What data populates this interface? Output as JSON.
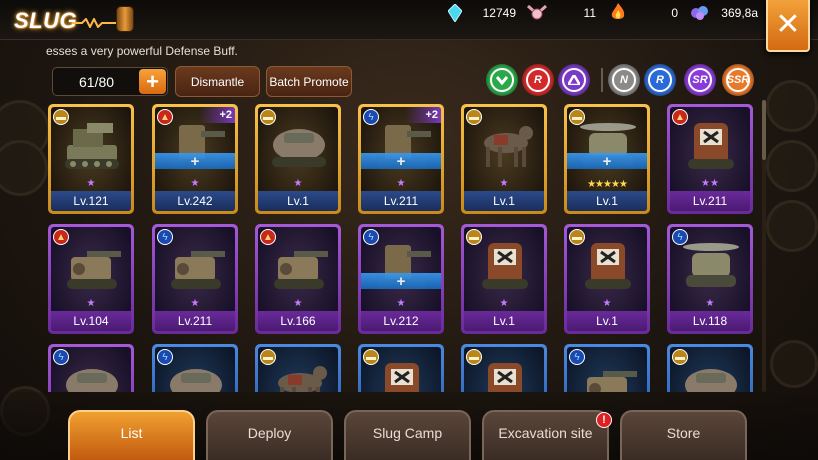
{
  "header": {
    "logo_text": "SLUG",
    "currencies": [
      {
        "icon": "crystal-icon",
        "value": "12749"
      },
      {
        "icon": "medal-icon",
        "value": "11"
      },
      {
        "icon": "fire-icon",
        "value": "0"
      },
      {
        "icon": "gem-pile-icon",
        "value": "369,8a"
      }
    ],
    "close_icon": "close-icon"
  },
  "description": "esses a very powerful Defense Buff.",
  "controls": {
    "capacity": "61/80",
    "expand_label": "+",
    "dismantle_label": "Dismantle",
    "batch_promote_label": "Batch Promote"
  },
  "filters": [
    {
      "label": "",
      "icon": "chevron-down-icon",
      "color": "#2aa84a"
    },
    {
      "label": "R",
      "icon": "rarity-r-icon",
      "color": "#d22a2a"
    },
    {
      "label": "",
      "icon": "triangle-up-icon",
      "color": "#7a3ac8"
    },
    {
      "label": "N",
      "icon": "rarity-n-icon",
      "color": "#8a8a8a"
    },
    {
      "label": "R",
      "icon": "rarity-r-blue-icon",
      "color": "#2a6ad8"
    },
    {
      "label": "SR",
      "icon": "rarity-sr-icon",
      "color": "#8a3ad8"
    },
    {
      "label": "SSR",
      "icon": "rarity-ssr-icon",
      "color": "#e8782a"
    }
  ],
  "units": [
    {
      "level": "Lv.121",
      "frame": "gold",
      "type": "gun",
      "stars": 1,
      "plus": "",
      "equip": false
    },
    {
      "level": "Lv.242",
      "frame": "gold",
      "type": "fire",
      "stars": 1,
      "plus": "+2",
      "equip": true
    },
    {
      "level": "Lv.1",
      "frame": "gold",
      "type": "gun",
      "stars": 1,
      "plus": "",
      "equip": false
    },
    {
      "level": "Lv.211",
      "frame": "gold",
      "type": "bolt",
      "stars": 1,
      "plus": "+2",
      "equip": true
    },
    {
      "level": "Lv.1",
      "frame": "gold",
      "type": "gun",
      "stars": 1,
      "plus": "",
      "equip": false
    },
    {
      "level": "Lv.1",
      "frame": "gold",
      "type": "gun",
      "stars": 5,
      "plus": "",
      "equip": true
    },
    {
      "level": "Lv.211",
      "frame": "purple",
      "type": "fire",
      "stars": 2,
      "plus": "",
      "equip": false
    },
    {
      "level": "Lv.104",
      "frame": "purple",
      "type": "fire",
      "stars": 1,
      "plus": "",
      "equip": false
    },
    {
      "level": "Lv.211",
      "frame": "purple",
      "type": "bolt",
      "stars": 1,
      "plus": "",
      "equip": false
    },
    {
      "level": "Lv.166",
      "frame": "purple",
      "type": "fire",
      "stars": 1,
      "plus": "",
      "equip": false
    },
    {
      "level": "Lv.212",
      "frame": "purple",
      "type": "bolt",
      "stars": 1,
      "plus": "",
      "equip": true
    },
    {
      "level": "Lv.1",
      "frame": "purple",
      "type": "gun",
      "stars": 1,
      "plus": "",
      "equip": false
    },
    {
      "level": "Lv.1",
      "frame": "purple",
      "type": "gun",
      "stars": 1,
      "plus": "",
      "equip": false
    },
    {
      "level": "Lv.118",
      "frame": "purple",
      "type": "bolt",
      "stars": 1,
      "plus": "",
      "equip": false
    },
    {
      "level": "",
      "frame": "purple",
      "type": "bolt",
      "stars": 0,
      "plus": "",
      "equip": false
    },
    {
      "level": "",
      "frame": "blue",
      "type": "bolt",
      "stars": 0,
      "plus": "",
      "equip": false
    },
    {
      "level": "",
      "frame": "blue",
      "type": "gun",
      "stars": 0,
      "plus": "",
      "equip": false
    },
    {
      "level": "",
      "frame": "blue",
      "type": "gun",
      "stars": 0,
      "plus": "",
      "equip": false
    },
    {
      "level": "",
      "frame": "blue",
      "type": "gun",
      "stars": 0,
      "plus": "",
      "equip": false
    },
    {
      "level": "",
      "frame": "blue",
      "type": "bolt",
      "stars": 0,
      "plus": "",
      "equip": false
    },
    {
      "level": "",
      "frame": "blue",
      "type": "gun",
      "stars": 0,
      "plus": "",
      "equip": false
    }
  ],
  "tabs": [
    {
      "label": "List",
      "active": true
    },
    {
      "label": "Deploy",
      "active": false
    },
    {
      "label": "Slug Camp",
      "active": false
    },
    {
      "label": "Excavation site",
      "active": false,
      "badge": "!"
    },
    {
      "label": "Store",
      "active": false
    }
  ]
}
